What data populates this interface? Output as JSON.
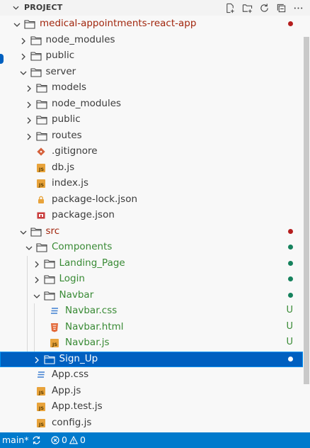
{
  "header": {
    "title": "PROJECT",
    "actions": [
      "new-file-icon",
      "new-folder-icon",
      "refresh-icon",
      "collapse-all-icon",
      "more-icon"
    ]
  },
  "colors": {
    "selection": "#0060c0",
    "modified_dot": "#b51e1e",
    "untracked_dot": "#16825d",
    "git_modified_text": "#a1260d",
    "git_untracked_text": "#388a34",
    "status_bar": "#007acc"
  },
  "tree": [
    {
      "label": "medical-appointments-react-app",
      "kind": "folder",
      "expanded": true,
      "depth": 0,
      "status": "red-dot"
    },
    {
      "label": "node_modules",
      "kind": "folder",
      "expanded": false,
      "depth": 1,
      "status": ""
    },
    {
      "label": "public",
      "kind": "folder",
      "expanded": false,
      "depth": 1,
      "status": ""
    },
    {
      "label": "server",
      "kind": "folder",
      "expanded": true,
      "depth": 1,
      "status": ""
    },
    {
      "label": "models",
      "kind": "folder",
      "expanded": false,
      "depth": 2,
      "status": ""
    },
    {
      "label": "node_modules",
      "kind": "folder",
      "expanded": false,
      "depth": 2,
      "status": ""
    },
    {
      "label": "public",
      "kind": "folder",
      "expanded": false,
      "depth": 2,
      "status": ""
    },
    {
      "label": "routes",
      "kind": "folder",
      "expanded": false,
      "depth": 2,
      "status": ""
    },
    {
      "label": ".gitignore",
      "kind": "file",
      "icon": "git-icon",
      "depth": 2,
      "status": ""
    },
    {
      "label": "db.js",
      "kind": "file",
      "icon": "js-icon",
      "depth": 2,
      "status": ""
    },
    {
      "label": "index.js",
      "kind": "file",
      "icon": "js-icon",
      "depth": 2,
      "status": ""
    },
    {
      "label": "package-lock.json",
      "kind": "file",
      "icon": "npm-lock-icon",
      "depth": 2,
      "status": ""
    },
    {
      "label": "package.json",
      "kind": "file",
      "icon": "npm-icon",
      "depth": 2,
      "status": ""
    },
    {
      "label": "src",
      "kind": "folder",
      "expanded": true,
      "depth": 1,
      "status": "red-dot"
    },
    {
      "label": "Components",
      "kind": "folder",
      "expanded": true,
      "depth": 2,
      "status": "green-dot"
    },
    {
      "label": "Landing_Page",
      "kind": "folder",
      "expanded": false,
      "depth": 3,
      "status": "green-dot"
    },
    {
      "label": "Login",
      "kind": "folder",
      "expanded": false,
      "depth": 3,
      "status": "green-dot"
    },
    {
      "label": "Navbar",
      "kind": "folder",
      "expanded": true,
      "depth": 3,
      "status": "green-dot"
    },
    {
      "label": "Navbar.css",
      "kind": "file",
      "icon": "css-icon",
      "depth": 4,
      "status": "U"
    },
    {
      "label": "Navbar.html",
      "kind": "file",
      "icon": "html-icon",
      "depth": 4,
      "status": "U"
    },
    {
      "label": "Navbar.js",
      "kind": "file",
      "icon": "js-icon",
      "depth": 4,
      "status": "U"
    },
    {
      "label": "Sign_Up",
      "kind": "folder",
      "expanded": false,
      "depth": 3,
      "status": "white-dot",
      "selected": true
    },
    {
      "label": "App.css",
      "kind": "file",
      "icon": "css-icon",
      "depth": 2,
      "status": ""
    },
    {
      "label": "App.js",
      "kind": "file",
      "icon": "js-icon",
      "depth": 2,
      "status": ""
    },
    {
      "label": "App.test.js",
      "kind": "file",
      "icon": "js-icon",
      "depth": 2,
      "status": ""
    },
    {
      "label": "config.js",
      "kind": "file",
      "icon": "js-icon",
      "depth": 2,
      "status": ""
    }
  ],
  "statusbar": {
    "branch": "main*",
    "errors": "0",
    "warnings": "0"
  }
}
